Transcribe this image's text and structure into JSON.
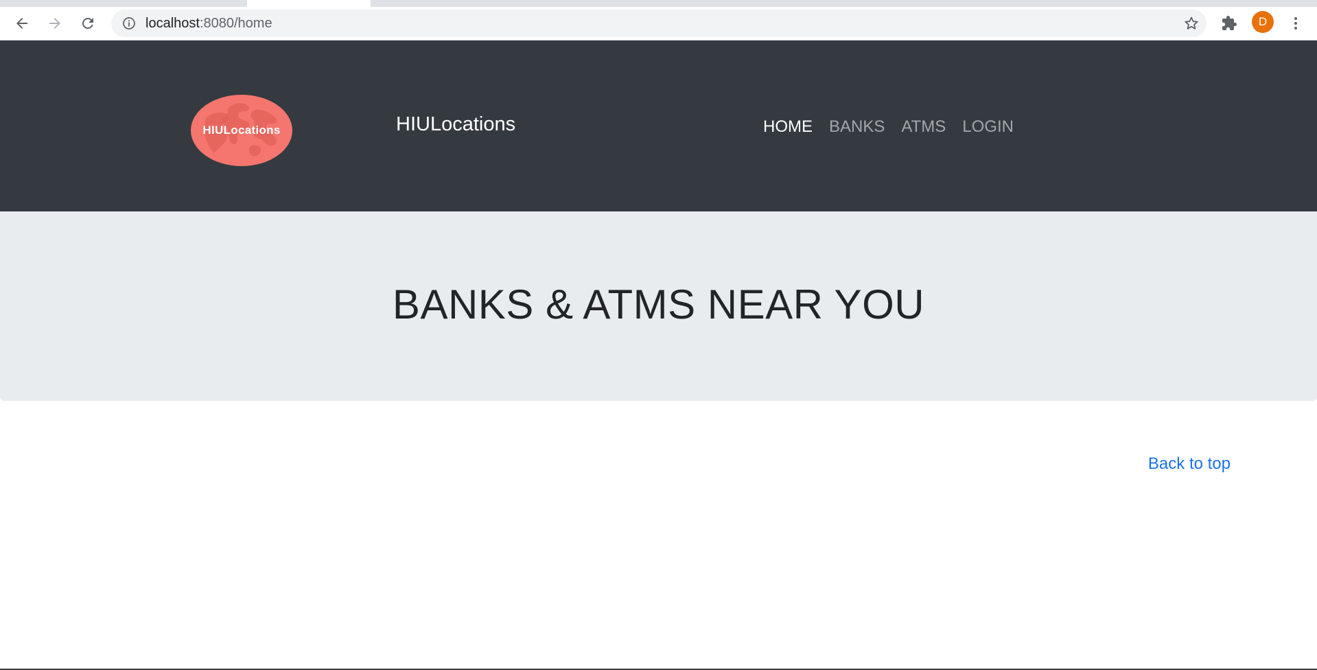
{
  "browser": {
    "url_host": "localhost",
    "url_path": ":8080/home",
    "avatar_initial": "D",
    "icons": [
      "back-arrow-icon",
      "forward-arrow-icon",
      "reload-icon",
      "info-icon",
      "star-icon",
      "puzzle-icon",
      "kebab-menu-icon"
    ]
  },
  "header": {
    "logo_text": "HIULocations",
    "brand": "HIULocations",
    "nav": {
      "home": "HOME",
      "banks": "BANKS",
      "atms": "ATMS",
      "login": "LOGIN"
    }
  },
  "hero": {
    "title": "BANKS & ATMS NEAR YOU"
  },
  "footer": {
    "back_to_top": "Back to top"
  },
  "colors": {
    "header_bg": "#343a40",
    "hero_bg": "#e9ecef",
    "logo": "#f4766e",
    "link": "#1a73e8",
    "avatar": "#e8710a"
  }
}
